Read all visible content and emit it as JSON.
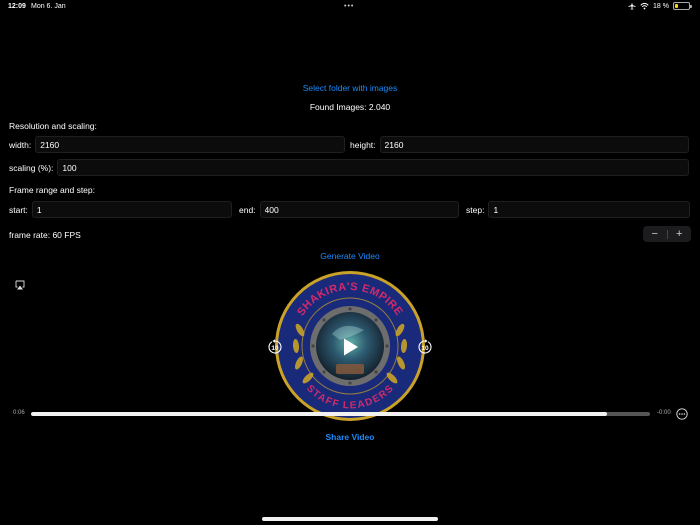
{
  "status_bar": {
    "time": "12:09",
    "date": "Mon 6. Jan",
    "battery_percent": "18 %",
    "battery_level": 0.18
  },
  "select_folder_label": "Select folder with images",
  "found_images": "Found Images: 2.040",
  "resolution_section": {
    "heading": "Resolution and scaling:",
    "width_label": "width:",
    "width_value": "2160",
    "height_label": "height:",
    "height_value": "2160",
    "scaling_label": "scaling (%):",
    "scaling_value": "100"
  },
  "frame_section": {
    "heading": "Frame range and step:",
    "start_label": "start:",
    "start_value": "1",
    "end_label": "end:",
    "end_value": "400",
    "step_label": "step:",
    "step_value": "1"
  },
  "frame_rate": {
    "label": "frame rate: 60 FPS",
    "decrement": "−",
    "increment": "+"
  },
  "generate_video_label": "Generate Video",
  "player": {
    "elapsed": "0:06",
    "remaining": "-0:00",
    "progress": 0.93,
    "badge_top_text": "SHAKIRA'S EMPIRE",
    "badge_bottom_text": "STAFF LEADERS",
    "skip_seconds": "10",
    "colors": {
      "navy": "#1a2a7a",
      "gold": "#c9a227",
      "ring_text": "#d12a6a"
    }
  },
  "share_video_label": "Share Video",
  "icons": [
    "airplane-icon",
    "wifi-icon",
    "battery-icon",
    "airplay-icon",
    "rewind-10-icon",
    "play-icon",
    "forward-10-icon",
    "more-icon"
  ]
}
